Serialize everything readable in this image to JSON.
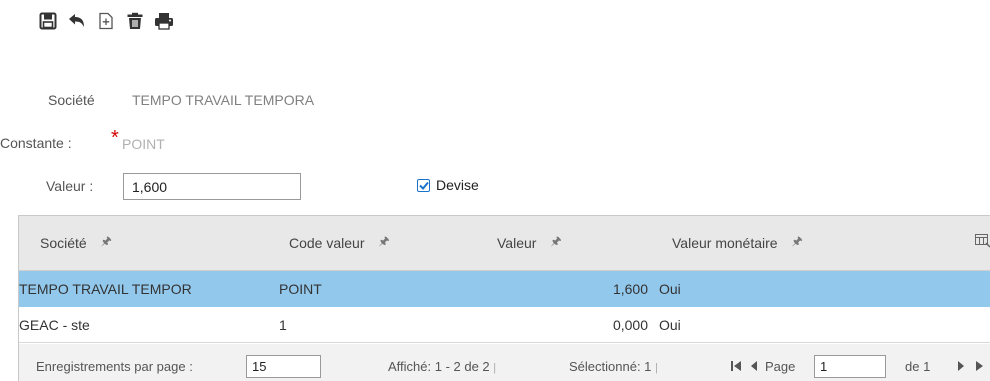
{
  "toolbar": {
    "icons": [
      "save-icon",
      "undo-icon",
      "new-record-icon",
      "delete-icon",
      "print-icon"
    ]
  },
  "form": {
    "societe_label": "Société",
    "societe_value": "TEMPO TRAVAIL TEMPORA",
    "constante_label": "Constante :",
    "required_marker": "*",
    "constante_value": "POINT",
    "valeur_label": "Valeur :",
    "valeur_value": "1,600",
    "devise_label": "Devise",
    "devise_checked": true
  },
  "grid": {
    "columns": [
      "Société",
      "Code valeur",
      "Valeur",
      "Valeur monétaire"
    ],
    "rows": [
      {
        "societe": "TEMPO TRAVAIL TEMPOR",
        "code": "POINT",
        "valeur": "1,600",
        "monetaire": "Oui",
        "selected": true
      },
      {
        "societe": "GEAC - ste",
        "code": "1",
        "valeur": "0,000",
        "monetaire": "Oui",
        "selected": false
      }
    ]
  },
  "pager": {
    "per_page_label": "Enregistrements par page :",
    "per_page_value": "15",
    "shown": "Affiché: 1 - 2 de 2",
    "separator": "|",
    "selected": "Sélectionné: 1",
    "page_label": "Page",
    "page_value": "1",
    "of_label": "de 1"
  },
  "colors": {
    "selected_row": "#92c8ec",
    "header_bg": "#e8e8e8",
    "required": "#d40000",
    "checkbox_accent": "#1a73c9"
  }
}
